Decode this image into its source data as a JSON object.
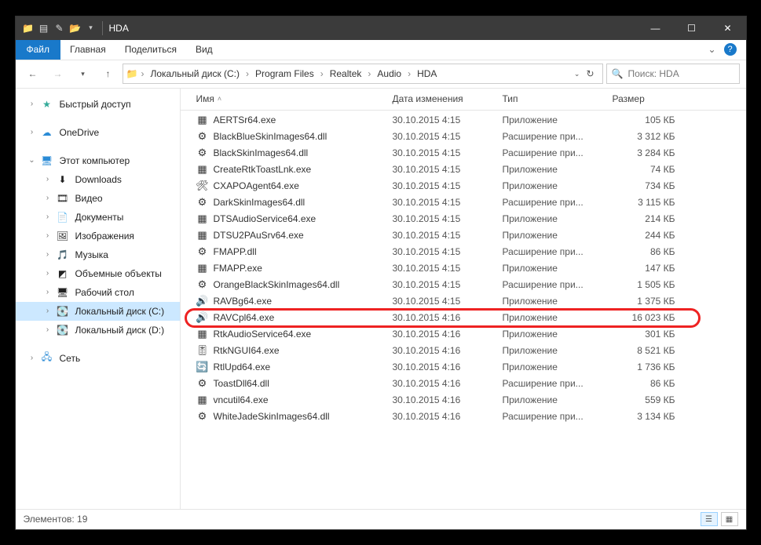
{
  "title": "HDA",
  "ribbon": {
    "file": "Файл",
    "tabs": [
      "Главная",
      "Поделиться",
      "Вид"
    ]
  },
  "breadcrumbs": [
    "Локальный диск (C:)",
    "Program Files",
    "Realtek",
    "Audio",
    "HDA"
  ],
  "search": {
    "placeholder": "Поиск: HDA"
  },
  "nav": {
    "quick": "Быстрый доступ",
    "onedrive": "OneDrive",
    "pc": "Этот компьютер",
    "pcitems": [
      {
        "label": "Downloads",
        "icon": "⬇"
      },
      {
        "label": "Видео",
        "icon": "🎞"
      },
      {
        "label": "Документы",
        "icon": "📄"
      },
      {
        "label": "Изображения",
        "icon": "🖼"
      },
      {
        "label": "Музыка",
        "icon": "🎵"
      },
      {
        "label": "Объемные объекты",
        "icon": "◩"
      },
      {
        "label": "Рабочий стол",
        "icon": "🖥"
      },
      {
        "label": "Локальный диск (C:)",
        "icon": "💽",
        "sel": true
      },
      {
        "label": "Локальный диск (D:)",
        "icon": "💽"
      }
    ],
    "network": "Сеть"
  },
  "cols": {
    "name": "Имя",
    "date": "Дата изменения",
    "type": "Тип",
    "size": "Размер"
  },
  "files": [
    {
      "n": "AERTSr64.exe",
      "d": "30.10.2015 4:15",
      "t": "Приложение",
      "s": "105 КБ",
      "ic": "app"
    },
    {
      "n": "BlackBlueSkinImages64.dll",
      "d": "30.10.2015 4:15",
      "t": "Расширение при...",
      "s": "3 312 КБ",
      "ic": "dll"
    },
    {
      "n": "BlackSkinImages64.dll",
      "d": "30.10.2015 4:15",
      "t": "Расширение при...",
      "s": "3 284 КБ",
      "ic": "dll"
    },
    {
      "n": "CreateRtkToastLnk.exe",
      "d": "30.10.2015 4:15",
      "t": "Приложение",
      "s": "74 КБ",
      "ic": "app"
    },
    {
      "n": "CXAPOAgent64.exe",
      "d": "30.10.2015 4:15",
      "t": "Приложение",
      "s": "734 КБ",
      "ic": "tool"
    },
    {
      "n": "DarkSkinImages64.dll",
      "d": "30.10.2015 4:15",
      "t": "Расширение при...",
      "s": "3 115 КБ",
      "ic": "dll"
    },
    {
      "n": "DTSAudioService64.exe",
      "d": "30.10.2015 4:15",
      "t": "Приложение",
      "s": "214 КБ",
      "ic": "app"
    },
    {
      "n": "DTSU2PAuSrv64.exe",
      "d": "30.10.2015 4:15",
      "t": "Приложение",
      "s": "244 КБ",
      "ic": "app"
    },
    {
      "n": "FMAPP.dll",
      "d": "30.10.2015 4:15",
      "t": "Расширение при...",
      "s": "86 КБ",
      "ic": "dll"
    },
    {
      "n": "FMAPP.exe",
      "d": "30.10.2015 4:15",
      "t": "Приложение",
      "s": "147 КБ",
      "ic": "app"
    },
    {
      "n": "OrangeBlackSkinImages64.dll",
      "d": "30.10.2015 4:15",
      "t": "Расширение при...",
      "s": "1 505 КБ",
      "ic": "dll"
    },
    {
      "n": "RAVBg64.exe",
      "d": "30.10.2015 4:15",
      "t": "Приложение",
      "s": "1 375 КБ",
      "ic": "snd"
    },
    {
      "n": "RAVCpl64.exe",
      "d": "30.10.2015 4:16",
      "t": "Приложение",
      "s": "16 023 КБ",
      "ic": "snd",
      "hl": true
    },
    {
      "n": "RtkAudioService64.exe",
      "d": "30.10.2015 4:16",
      "t": "Приложение",
      "s": "301 КБ",
      "ic": "app"
    },
    {
      "n": "RtkNGUI64.exe",
      "d": "30.10.2015 4:16",
      "t": "Приложение",
      "s": "8 521 КБ",
      "ic": "mix"
    },
    {
      "n": "RtlUpd64.exe",
      "d": "30.10.2015 4:16",
      "t": "Приложение",
      "s": "1 736 КБ",
      "ic": "upd"
    },
    {
      "n": "ToastDll64.dll",
      "d": "30.10.2015 4:16",
      "t": "Расширение при...",
      "s": "86 КБ",
      "ic": "dll"
    },
    {
      "n": "vncutil64.exe",
      "d": "30.10.2015 4:16",
      "t": "Приложение",
      "s": "559 КБ",
      "ic": "app"
    },
    {
      "n": "WhiteJadeSkinImages64.dll",
      "d": "30.10.2015 4:16",
      "t": "Расширение при...",
      "s": "3 134 КБ",
      "ic": "dll"
    }
  ],
  "status": {
    "count": "Элементов: 19"
  },
  "ic": {
    "app": "▦",
    "dll": "⚙",
    "snd": "🔊",
    "tool": "🛠",
    "mix": "🎚",
    "upd": "🔄"
  }
}
